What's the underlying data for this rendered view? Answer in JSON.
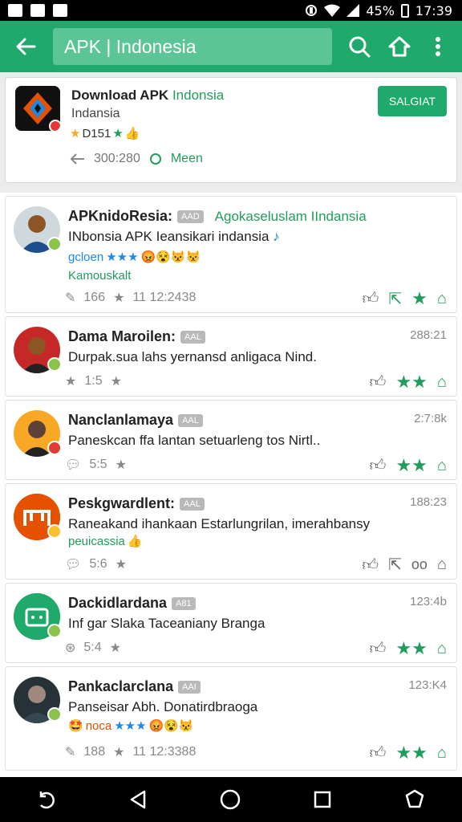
{
  "status_bar": {
    "battery_percent": "45%",
    "time": "17:39"
  },
  "toolbar": {
    "search_text": "APK | Indonesia"
  },
  "app_header": {
    "title_bold": "Download APK",
    "title_green": "Indonsia",
    "subtitle": "Indansia",
    "rating_text": "D151",
    "downloads": "300:280",
    "meta_label": "Meen",
    "install_label": "SALGIAT"
  },
  "reviews": [
    {
      "name": "APKnidoResia:",
      "tag": "AAD",
      "source": "Agokaseluslam IIndansia",
      "text": "INbonsia APK Ieansikari indansia",
      "extra1": "gcloen",
      "extra2": "Kamouskalt",
      "count": "166",
      "time_footer": "11 12:2438",
      "avatar_color": "#1d4f8e",
      "badge_color": "#8bc34a"
    },
    {
      "name": "Dama Maroilen:",
      "tag": "AAL",
      "time": "288:21",
      "text": "Durpak.sua lahs yernansd anligaca Nind.",
      "count": "1:5",
      "avatar_color": "#c62828",
      "badge_color": "#8bc34a"
    },
    {
      "name": "Nanclanlamaya",
      "tag": "AAL",
      "time": "2:7:8k",
      "text": "Paneskcan ffa lantan setuarleng tos Nirtl..",
      "count": "5:5",
      "avatar_color": "#f9a825",
      "badge_color": "#e53935"
    },
    {
      "name": "Peskgwardlent:",
      "tag": "AAL",
      "time": "188:23",
      "text": "Raneakand ihankaan Estarlungrilan, imerahbansy",
      "extra1": "peuicassia",
      "count": "5:6",
      "avatar_color": "#e65100",
      "badge_color": "#fbc02d"
    },
    {
      "name": "Dackidlardana",
      "tag": "A81",
      "time": "123:4b",
      "text": "Inf gar Slaka Taceaniany Branga",
      "count": "5:4",
      "avatar_color": "#1faa6b",
      "badge_color": "#8bc34a"
    },
    {
      "name": "Pankaclarclana",
      "tag": "AAI",
      "time": "123:K4",
      "text": "Panseisar Abh. Donatirdbraoga",
      "extra1": "noca",
      "count": "188",
      "time_footer": "11 12:3388",
      "avatar_color": "#263238",
      "badge_color": "#8bc34a"
    }
  ],
  "colors": {
    "primary": "#1faa6b",
    "green_text": "#1e9e5a"
  }
}
